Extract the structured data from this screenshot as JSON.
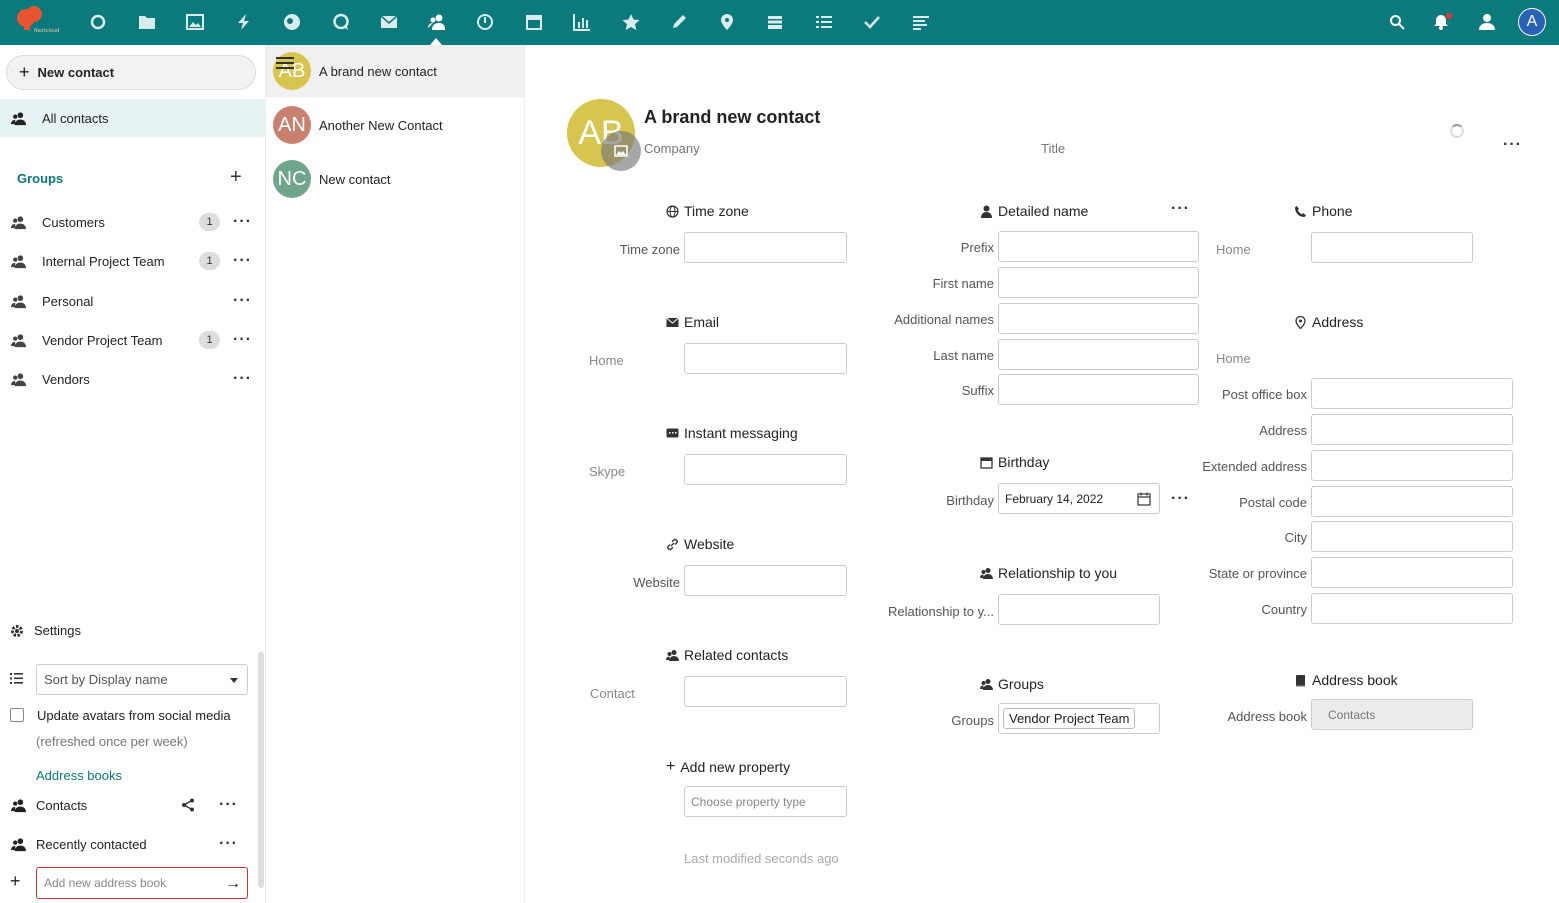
{
  "header": {
    "apps": [
      "dashboard-icon",
      "files-icon",
      "photos-icon",
      "activity-icon",
      "circles-icon",
      "talk-icon",
      "mail-icon",
      "contacts-icon",
      "timeline-icon",
      "calendar-icon",
      "analytics-icon",
      "bookmarks-icon",
      "notes-icon",
      "maps-icon",
      "deck-icon",
      "tasks-list-icon",
      "tasks-icon",
      "forms-icon"
    ],
    "active_app": "contacts-icon",
    "user_initial": "A",
    "accent": "#0a7a7c"
  },
  "nav": {
    "new_contact": "New contact",
    "all_contacts": "All contacts",
    "groups_caption": "Groups",
    "groups": [
      {
        "label": "Customers",
        "count": "1"
      },
      {
        "label": "Internal Project Team",
        "count": "1"
      },
      {
        "label": "Personal",
        "count": ""
      },
      {
        "label": "Vendor Project Team",
        "count": "1"
      },
      {
        "label": "Vendors",
        "count": ""
      }
    ],
    "settings": "Settings",
    "sort_value": "Sort by Display name",
    "update_avatars": "Update avatars from social media",
    "update_avatars_sub": "(refreshed once per week)",
    "address_books_caption": "Address books",
    "address_books": [
      "Contacts",
      "Recently contacted"
    ],
    "add_address_book_placeholder": "Add new address book"
  },
  "contacts": [
    {
      "initials": "AB",
      "name": "A brand new contact",
      "color": "#d8c54f"
    },
    {
      "initials": "AN",
      "name": "Another New Contact",
      "color": "#c9806e"
    },
    {
      "initials": "NC",
      "name": "New contact",
      "color": "#6fa58a"
    }
  ],
  "detail": {
    "initials": "AB",
    "name": "A brand new contact",
    "company_placeholder": "Company",
    "title_placeholder": "Title",
    "timezone": {
      "head": "Time zone",
      "label": "Time zone"
    },
    "email": {
      "head": "Email",
      "label": "Home"
    },
    "im": {
      "head": "Instant messaging",
      "label": "Skype"
    },
    "website": {
      "head": "Website",
      "label": "Website"
    },
    "related": {
      "head": "Related contacts",
      "label": "Contact"
    },
    "add_property": {
      "head": "Add new property",
      "placeholder": "Choose property type"
    },
    "last_modified": "Last modified seconds ago",
    "detailed_name": {
      "head": "Detailed name",
      "labels": [
        "Prefix",
        "First name",
        "Additional names",
        "Last name",
        "Suffix"
      ]
    },
    "birthday": {
      "head": "Birthday",
      "label": "Birthday",
      "value": "February 14, 2022"
    },
    "relationship": {
      "head": "Relationship to you",
      "label": "Relationship to y..."
    },
    "groups": {
      "head": "Groups",
      "label": "Groups",
      "value": "Vendor Project Team"
    },
    "phone": {
      "head": "Phone",
      "label": "Home"
    },
    "address": {
      "head": "Address",
      "label": "Home",
      "fields": [
        "Post office box",
        "Address",
        "Extended address",
        "Postal code",
        "City",
        "State or province",
        "Country"
      ]
    },
    "address_book": {
      "head": "Address book",
      "label": "Address book",
      "value": "Contacts"
    }
  }
}
